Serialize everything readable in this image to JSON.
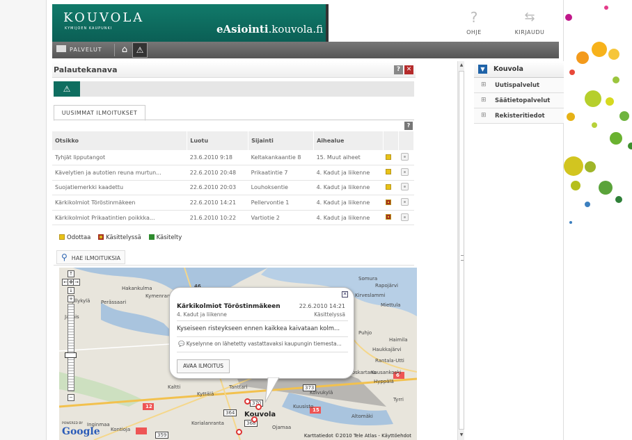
{
  "header": {
    "brand_name": "KOUVOLA",
    "brand_sub": "KYMIJOEN KAUPUNKI",
    "eservice_bold": "eAsiointi",
    "eservice_rest": ".kouvola.fi",
    "help_label": "OHJE",
    "login_label": "KIRJAUDU"
  },
  "toolbar": {
    "services_label": "PALVELUT",
    "home_icon": "home-icon",
    "warning_icon": "warning-icon"
  },
  "panel": {
    "title": "Palautekanava",
    "help_glyph": "?",
    "close_glyph": "✕",
    "tab_label": "UUSIMMAT ILMOITUKSET",
    "table_help_glyph": "?"
  },
  "table": {
    "headers": [
      "Otsikko",
      "Luotu",
      "Sijainti",
      "Aihealue"
    ],
    "rows": [
      {
        "title": "Tyhjät lipputangot",
        "created": "23.6.2010 9:18",
        "location": "Keltakankaantie 8",
        "category": "15. Muut aiheet",
        "status": "waiting"
      },
      {
        "title": "Kävelytien ja autotien reuna murtun...",
        "created": "22.6.2010 20:48",
        "location": "Prikaatintie 7",
        "category": "4. Kadut ja liikenne",
        "status": "waiting"
      },
      {
        "title": "Suojatiemerkki kaadettu",
        "created": "22.6.2010 20:03",
        "location": "Louhoksentie",
        "category": "4. Kadut ja liikenne",
        "status": "waiting"
      },
      {
        "title": "Kärkikolmiot Töröstinmäkeen",
        "created": "22.6.2010 14:21",
        "location": "Pellervontie 1",
        "category": "4. Kadut ja liikenne",
        "status": "processing"
      },
      {
        "title": "Kärkikolmiot Prikaatintien poikkka...",
        "created": "21.6.2010 10:22",
        "location": "Vartiotie 2",
        "category": "4. Kadut ja liikenne",
        "status": "processing"
      }
    ]
  },
  "legend": {
    "waiting": "Odottaa",
    "processing": "Käsittelyssä",
    "done": "Käsitelty",
    "colors": {
      "waiting": "#e8c218",
      "processing": "#d9b21c",
      "done": "#2e8b2e"
    }
  },
  "search": {
    "label": "HAE ILMOITUKSIA"
  },
  "map": {
    "places": [
      "Somura",
      "Rapojärvi",
      "Hakankulma",
      "Kymenranta",
      "Kirveslammi",
      "Perässaari",
      "Miettula",
      "Myllykylä",
      "Jaanis",
      "Puhjo",
      "Haimila",
      "Haukkajärvi",
      "Rantala-Utti",
      "Kuutoskartano",
      "Kuusankoski",
      "Hyppälä",
      "Kaltti",
      "Tanttari",
      "Kyttälä",
      "Koivukylä",
      "Tyrri",
      "Kuusisto",
      "Korialanranta",
      "Ojamaa",
      "Altomäki",
      "Kouvola",
      "Inginmaa",
      "Kontioja"
    ],
    "roads": [
      "46",
      "12",
      "15",
      "6",
      "359",
      "364",
      "373",
      "370",
      "368"
    ],
    "popup": {
      "title": "Kärkikolmiot Töröstinmäkeen",
      "date": "22.6.2010 14:21",
      "category": "4. Kadut ja liikenne",
      "status": "Käsittelyssä",
      "description": "Kyseiseen risteykseen ennen kaikkea kaivataan kolm...",
      "note": "Kyselynne on lähetetty vastattavaksi kaupungin tiemesta...",
      "open_button": "AVAA ILMOITUS",
      "close_glyph": "✕"
    },
    "powered_by": "POWERED BY",
    "google": "Google",
    "copyright": "Karttatiedot ©2010 Tele Atlas - Käyttöehdot"
  },
  "sidebar": {
    "title": "Kouvola",
    "items": [
      {
        "label": "Uutispalvelut"
      },
      {
        "label": "Säätietopalvelut"
      },
      {
        "label": "Rekisteritiedot"
      }
    ]
  }
}
